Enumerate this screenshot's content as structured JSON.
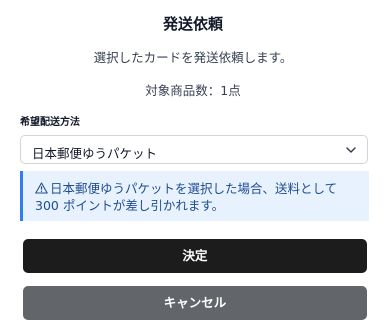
{
  "dialog": {
    "title": "発送依頼",
    "description": "選択したカードを発送依頼します。",
    "item_count": "対象商品数：1点"
  },
  "shipping": {
    "label": "希望配送方法",
    "selected": "日本郵便ゆうパケット",
    "chevron_icon": "chevron-down-icon"
  },
  "notice": {
    "icon": "warning-icon",
    "line1": "日本郵便ゆうパケットを選択した場合、送料として",
    "line2": "300 ポイントが差し引かれます。",
    "accent_color": "#2f80ed",
    "background_color": "#e8f2ff"
  },
  "buttons": {
    "confirm": "決定",
    "cancel": "キャンセル"
  }
}
